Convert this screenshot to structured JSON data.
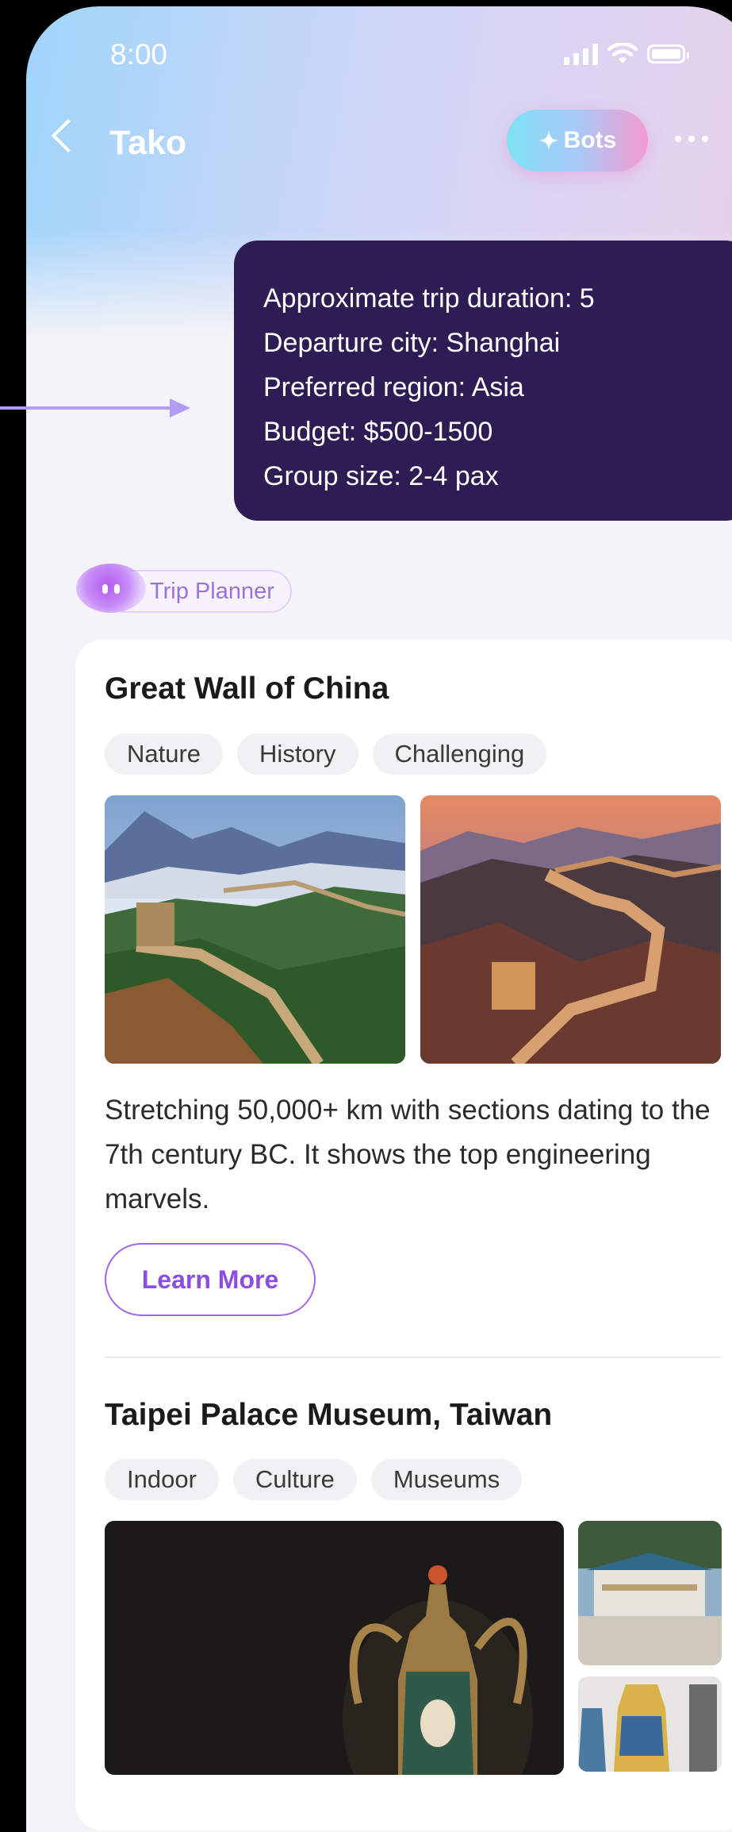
{
  "status": {
    "time": "8:00"
  },
  "header": {
    "title": "Tako",
    "bots_label": "Bots"
  },
  "message": {
    "lines": [
      "Approximate trip duration: 5",
      "Departure city: Shanghai",
      "Preferred region: Asia",
      "Budget: $500-1500",
      "Group size: 2-4 pax"
    ]
  },
  "bot": {
    "name": "Trip Planner"
  },
  "places": [
    {
      "title": "Great Wall of China",
      "tags": [
        "Nature",
        "History",
        "Challenging"
      ],
      "description": "Stretching 50,000+ km with sections dating to the 7th century BC. It shows the top engineering marvels.",
      "button": "Learn More"
    },
    {
      "title": "Taipei Palace Museum, Taiwan",
      "tags": [
        "Indoor",
        "Culture",
        "Museums"
      ]
    }
  ],
  "colors": {
    "bubble": "#2e1d54",
    "accent": "#8a4ee0",
    "card": "#ffffff"
  }
}
